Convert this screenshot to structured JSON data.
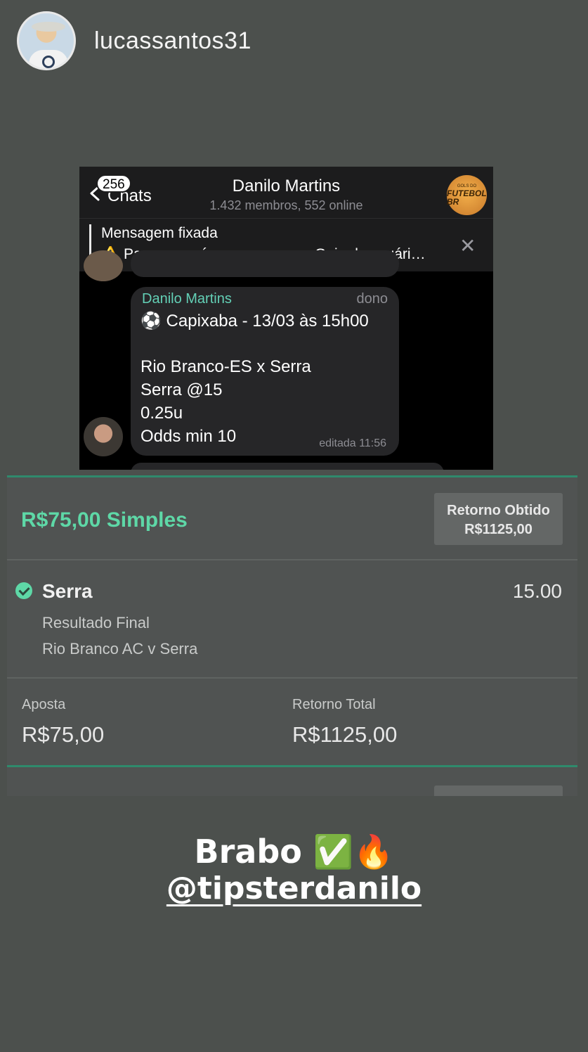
{
  "story": {
    "username": "lucassantos31",
    "caption_line1": "Brabo ✅🔥",
    "caption_mention": "@tipsterdanilo"
  },
  "telegram": {
    "back_label": "Chats",
    "unread_badge": "256",
    "chat_title": "Danilo Martins",
    "chat_subtitle": "1.432 membros, 552 online",
    "group_avatar_text_small": "GOLS DO",
    "group_avatar_text_main": "FUTEBOL BR",
    "pinned_title": "Mensagem fixada",
    "pinned_text": "⚠️ Para quem é novo no grupo: Guia do usuári…",
    "message": {
      "sender": "Danilo Martins",
      "role": "dono",
      "line1": "⚽ Capixaba - 13/03 às 15h00",
      "line2": "Rio Branco-ES x Serra",
      "line3": "Serra @15",
      "line4": "0.25u",
      "line5": "Odds min 10",
      "edited": "editada 11:56"
    }
  },
  "bet": {
    "stake_title": "R$75,00 Simples",
    "return_button_line1": "Retorno Obtido",
    "return_button_line2": "R$1125,00",
    "selection": "Serra",
    "odds": "15.00",
    "market": "Resultado Final",
    "event": "Rio Branco AC v Serra",
    "stake_label": "Aposta",
    "stake_value": "R$75,00",
    "total_return_label": "Retorno Total",
    "total_return_value": "R$1125,00"
  },
  "colors": {
    "accent_green": "#5ed8a7",
    "telegram_sender": "#63d0b6",
    "background": "#4c504d"
  }
}
